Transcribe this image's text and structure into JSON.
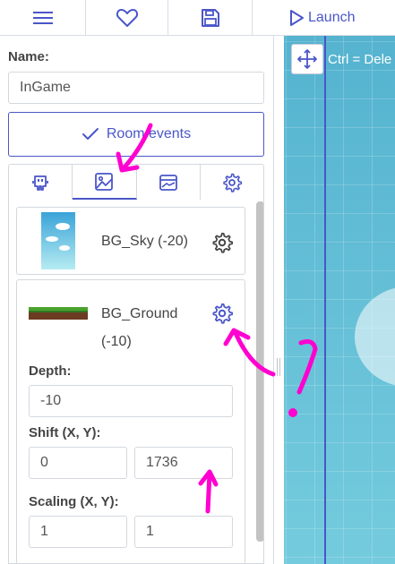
{
  "toolbar": {
    "launch_label": "Launch",
    "icons": [
      "menu-icon",
      "heart-icon",
      "save-icon",
      "play-icon"
    ]
  },
  "room": {
    "name_label": "Name:",
    "name_value": "InGame",
    "events_label": "Room events"
  },
  "tabs": [
    {
      "icon": "copies-icon",
      "active": false
    },
    {
      "icon": "image-icon",
      "active": true
    },
    {
      "icon": "background-icon",
      "active": false
    },
    {
      "icon": "gear-icon",
      "active": false
    }
  ],
  "backgrounds": [
    {
      "title": "BG_Sky (-20)"
    },
    {
      "title": "BG_Ground",
      "title_depth": "(-10)"
    }
  ],
  "fields": {
    "depth_label": "Depth:",
    "depth_value": "-10",
    "shift_label": "Shift (X, Y):",
    "shift_x": "0",
    "shift_y": "1736",
    "scaling_label": "Scaling (X, Y):",
    "scale_x": "1",
    "scale_y": "1"
  },
  "canvas": {
    "hint": "Ctrl = Dele"
  },
  "colors": {
    "accent": "#4a56c8",
    "annotation": "#ff00d0"
  }
}
